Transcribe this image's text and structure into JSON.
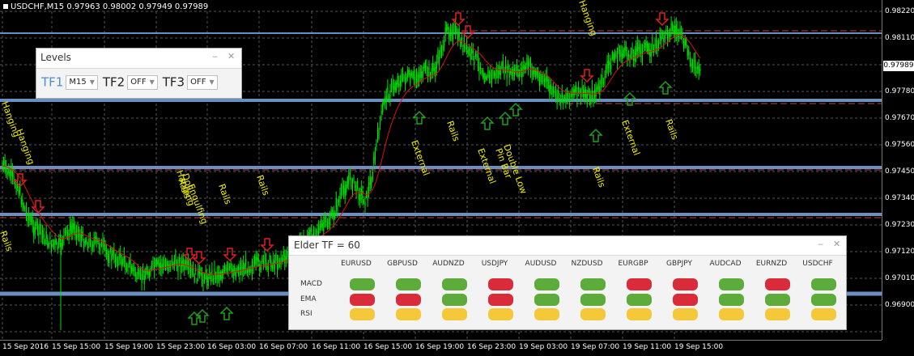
{
  "chart_title": "USDCHF,M15  0.97963 0.98002 0.97949 0.97989",
  "current_price": "0.97989",
  "price_ticks": [
    "0.98220",
    "0.98110",
    "0.97890",
    "0.97780",
    "0.97670",
    "0.97560",
    "0.97450",
    "0.97340",
    "0.97230",
    "0.97120",
    "0.97010",
    "0.96900"
  ],
  "time_ticks": [
    "15 Sep 2016",
    "15 Sep 15:00",
    "15 Sep 19:00",
    "15 Sep 23:00",
    "16 Sep 03:00",
    "16 Sep 07:00",
    "16 Sep 11:00",
    "16 Sep 15:00",
    "16 Sep 19:00",
    "16 Sep 23:00",
    "19 Sep 03:00",
    "19 Sep 07:00",
    "19 Sep 11:00",
    "19 Sep 15:00"
  ],
  "annotations": [
    "Hanging",
    "Hanging",
    "Rails",
    "Rails",
    "Doji",
    "Rails",
    "Hanging",
    "Engulfing",
    "Rails",
    "External",
    "Rails",
    "External",
    "Pin Bar",
    "Double Low",
    "Rails",
    "External",
    "Rails",
    "Hanging"
  ],
  "levels_panel": {
    "title": "Levels",
    "tf1_label": "TF1",
    "tf1_value": "M15",
    "tf2_label": "TF2",
    "tf2_value": "OFF",
    "tf3_label": "TF3",
    "tf3_value": "OFF"
  },
  "elder_panel": {
    "title": "Elder  TF = 60",
    "pairs": [
      "EURUSD",
      "GBPUSD",
      "AUDNZD",
      "USDJPY",
      "AUDUSD",
      "NZDUSD",
      "EURGBP",
      "GBPJPY",
      "AUDCAD",
      "EURNZD",
      "USDCHF"
    ],
    "rows": [
      {
        "label": "MACD",
        "states": [
          "green",
          "green",
          "green",
          "red",
          "green",
          "green",
          "red",
          "red",
          "green",
          "red",
          "green"
        ]
      },
      {
        "label": "EMA",
        "states": [
          "red",
          "red",
          "green",
          "red",
          "green",
          "green",
          "green",
          "red",
          "green",
          "green",
          "green"
        ]
      },
      {
        "label": "RSI",
        "states": [
          "yellow",
          "yellow",
          "yellow",
          "yellow",
          "yellow",
          "yellow",
          "yellow",
          "yellow",
          "yellow",
          "yellow",
          "yellow"
        ]
      }
    ]
  },
  "colors": {
    "green": "#5dab3a",
    "red": "#d92b3a",
    "yellow": "#f5c83a",
    "candle": "#00e000",
    "ma": "#e01010",
    "level": "#6a8fc0"
  }
}
